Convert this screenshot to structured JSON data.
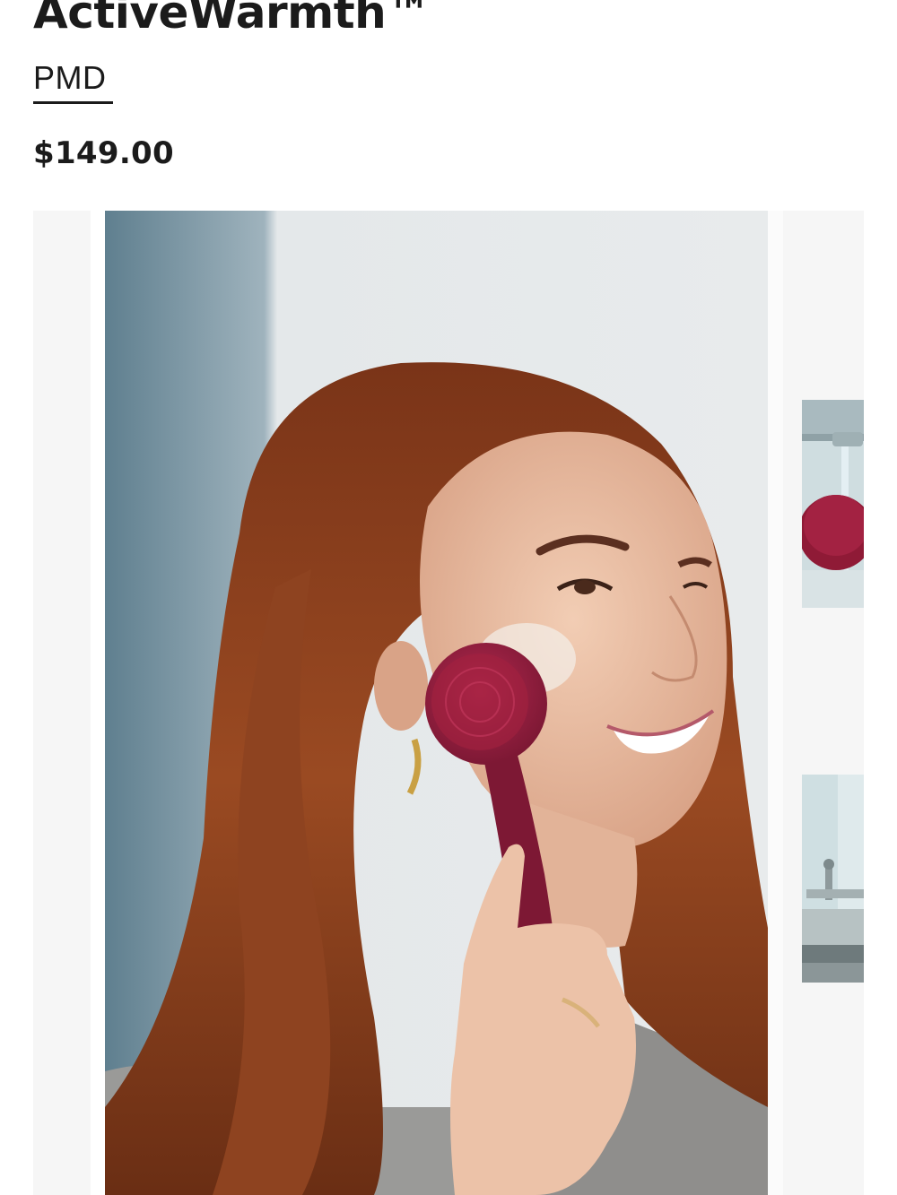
{
  "product": {
    "title": "ActiveWarmth™",
    "brand": "PMD",
    "price": "$149.00"
  },
  "gallery": {
    "main_image_alt": "Woman with long auburn hair cleansing her cheek with a burgundy silicone facial brush",
    "thumbnails": [
      {
        "alt": "Burgundy brush head under running faucet water"
      },
      {
        "alt": "Bathroom counter with faucet"
      }
    ]
  },
  "colors": {
    "text": "#1b1b1b",
    "brush": "#8a1f3f",
    "hair": "#8a3e1f"
  }
}
